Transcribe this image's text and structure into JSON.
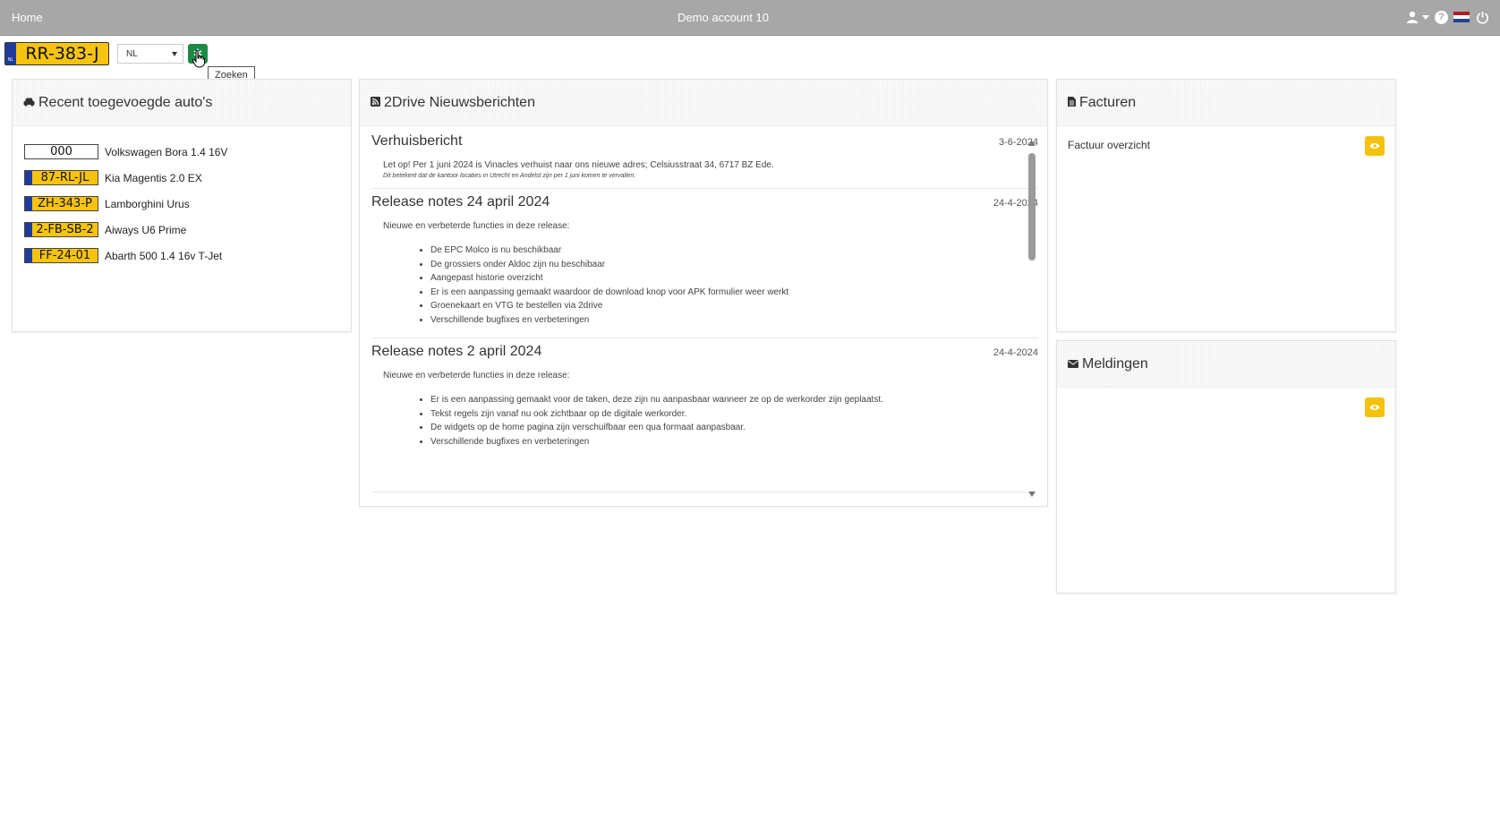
{
  "topbar": {
    "home": "Home",
    "account": "Demo account 10",
    "icons": [
      "user-icon",
      "chevron-down-icon",
      "help-icon",
      "nl-flag-icon",
      "power-icon"
    ],
    "help_glyph": "?",
    "flag_colors": [
      "#ae1c28",
      "#ffffff",
      "#21468b"
    ]
  },
  "search": {
    "plate_value": "RR-383-J",
    "country_label": "NL",
    "eu_badge": "NL",
    "search_tooltip": "Zoeken"
  },
  "colors": {
    "plate_yellow": "#f6c40f",
    "plate_blue": "#1f3d98",
    "search_green": "#1d8a45",
    "eye_yellow": "#f4c20d",
    "topbar_gray": "#a7a7a7"
  },
  "recent": {
    "title": "Recent toegevoegde auto's",
    "cars": [
      {
        "plate": "000",
        "name": "Volkswagen Bora 1.4 16V",
        "style": "white"
      },
      {
        "plate": "87-RL-JL",
        "name": "Kia Magentis 2.0 EX",
        "style": "yellow"
      },
      {
        "plate": "ZH-343-P",
        "name": "Lamborghini Urus",
        "style": "yellow"
      },
      {
        "plate": "2-FB-SB-2",
        "name": "Aiways U6 Prime",
        "style": "yellow"
      },
      {
        "plate": "FF-24-01",
        "name": "Abarth 500 1.4 16v T-Jet",
        "style": "yellow"
      }
    ]
  },
  "news": {
    "title": "2Drive Nieuwsberichten",
    "articles": [
      {
        "title": "Verhuisbericht",
        "date": "3-6-2024",
        "text": "Let op! Per 1 juni 2024 is Vinacles verhuist naar ons nieuwe adres; Celsiusstraat 34, 6717 BZ Ede.",
        "small": "Dit betekent dat de kantoor locaties in Utrecht en Andelst zijn per 1 juni komen te vervallen."
      },
      {
        "title": "Release notes 24 april 2024",
        "date": "24-4-2024",
        "text": "Nieuwe en verbeterde functies in deze release:",
        "items": [
          "De EPC Molco is nu beschikbaar",
          "De grossiers onder Aldoc zijn nu beschibaar",
          "Aangepast historie overzicht",
          "Er is een aanpassing gemaakt waardoor de download knop voor APK formulier weer werkt",
          "Groenekaart en VTG te bestellen via 2drive",
          "Verschillende bugfixes en verbeteringen"
        ]
      },
      {
        "title": "Release notes 2 april 2024",
        "date": "24-4-2024",
        "text": "Nieuwe en verbeterde functies in deze release:",
        "items": [
          "Er is een aanpassing gemaakt voor de taken, deze zijn nu aanpasbaar wanneer ze op de werkorder zijn geplaatst.",
          "Tekst regels zijn vanaf nu ook zichtbaar op de digitale werkorder.",
          "De widgets op de home pagina zijn verschuifbaar een qua formaat aanpasbaar.",
          "Verschillende bugfixes en verbeteringen"
        ]
      }
    ]
  },
  "invoices": {
    "title": "Facturen",
    "link": "Factuur overzicht"
  },
  "notifications": {
    "title": "Meldingen"
  }
}
